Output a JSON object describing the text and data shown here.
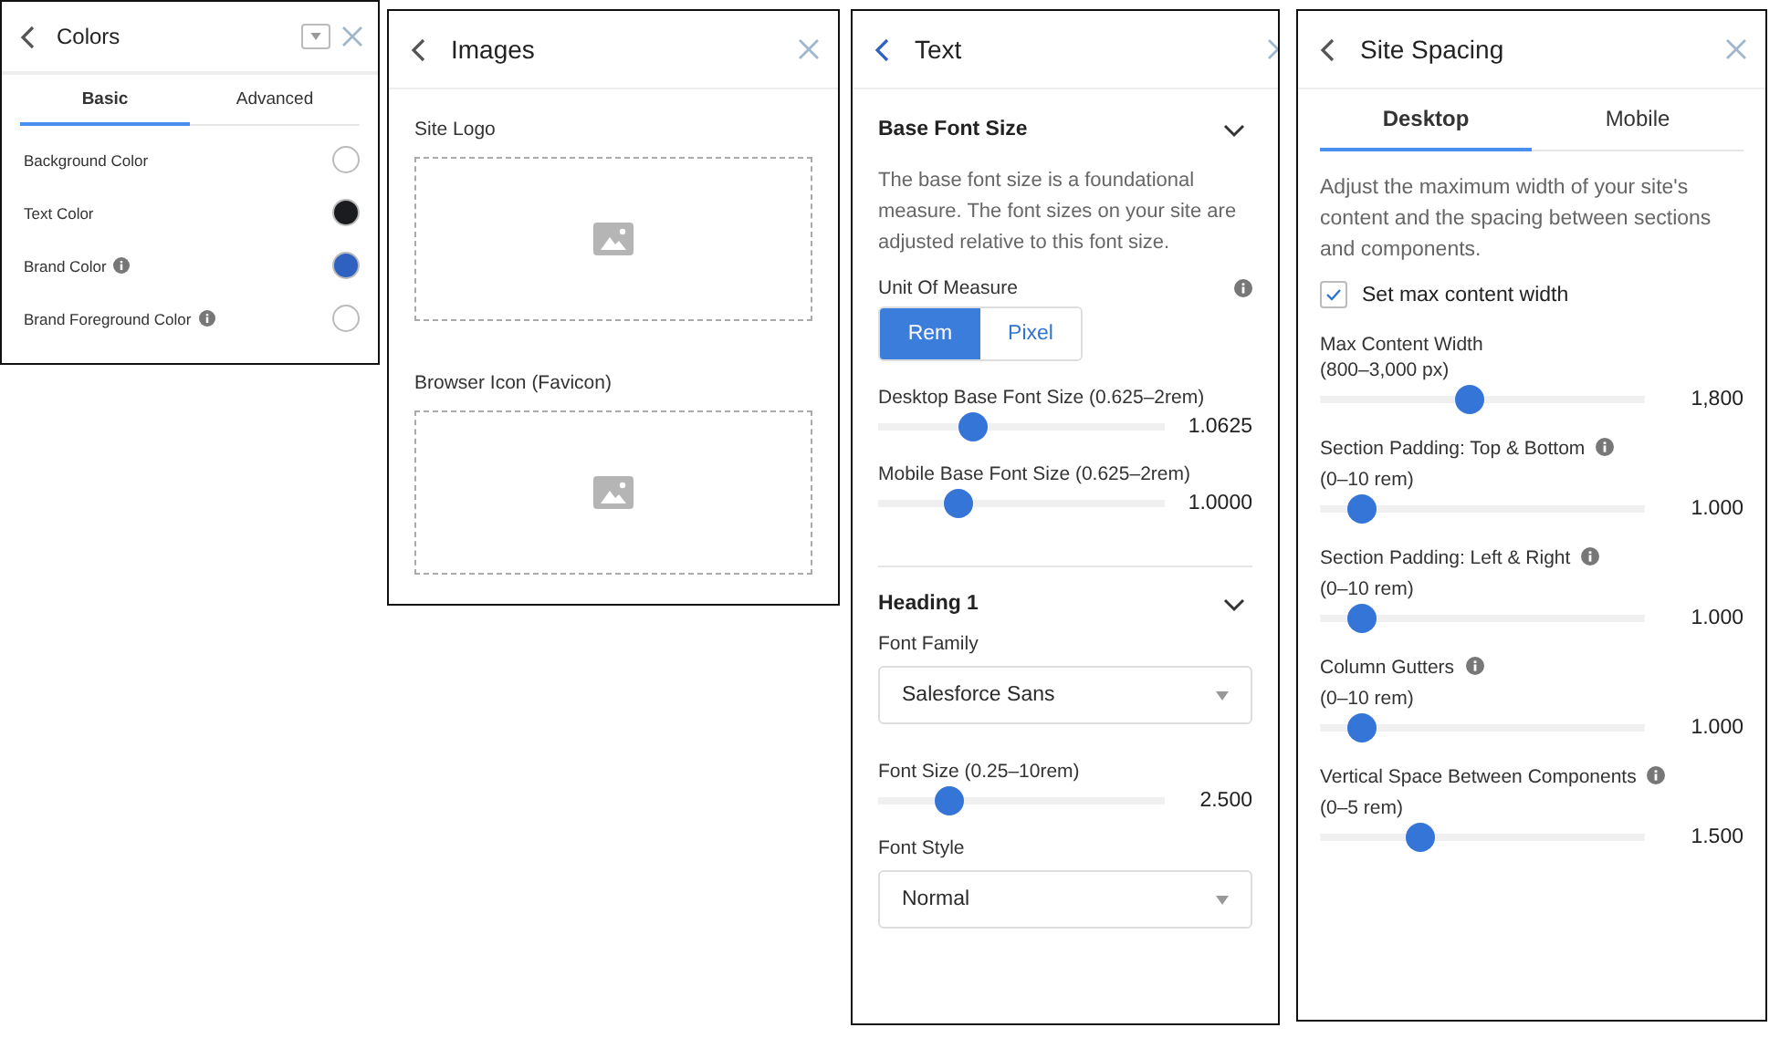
{
  "colors_panel": {
    "title": "Colors",
    "tabs": [
      {
        "label": "Basic",
        "selected": true
      },
      {
        "label": "Advanced",
        "selected": false
      }
    ],
    "items": [
      {
        "label": "Background Color",
        "info": false,
        "color": "#ffffff"
      },
      {
        "label": "Text Color",
        "info": false,
        "color": "#1b1c1f"
      },
      {
        "label": "Brand Color",
        "info": true,
        "color": "#2f62c0"
      },
      {
        "label": "Brand Foreground Color",
        "info": true,
        "color": "#ffffff"
      }
    ]
  },
  "images_panel": {
    "title": "Images",
    "slots": [
      {
        "label": "Site Logo"
      },
      {
        "label": "Browser Icon (Favicon)"
      }
    ]
  },
  "text_panel": {
    "title": "Text",
    "sections": [
      {
        "title": "Base Font Size",
        "expanded": true,
        "fields": [
          {
            "kind": "description",
            "text": "The base font size is a foundational measure. The font sizes on your site are adjusted relative to this font size."
          },
          {
            "kind": "toggle",
            "label": "Unit Of Measure",
            "info": true,
            "options": [
              {
                "label": "Rem",
                "selected": true
              },
              {
                "label": "Pixel",
                "selected": false
              }
            ]
          },
          {
            "kind": "slider",
            "label": "Desktop Base Font Size (0.625–2rem)",
            "level": 0.33,
            "reading": "1.0625"
          },
          {
            "kind": "slider",
            "label": "Mobile Base Font Size (0.625–2rem)",
            "level": 0.28,
            "reading": "1.0000"
          }
        ]
      },
      {
        "title": "Heading 1",
        "expanded": true,
        "fields": [
          {
            "kind": "select",
            "label": "Font Family",
            "value": "Salesforce Sans"
          },
          {
            "kind": "slider",
            "label": "Font Size (0.25–10rem)",
            "level": 0.25,
            "reading": "2.500"
          },
          {
            "kind": "select",
            "label": "Font Style",
            "value": "Normal"
          }
        ]
      }
    ]
  },
  "spacing_panel": {
    "title": "Site Spacing",
    "tabs": [
      {
        "label": "Desktop",
        "selected": true
      },
      {
        "label": "Mobile",
        "selected": false
      }
    ],
    "description": "Adjust the maximum width of your site's content and the spacing between sections and components.",
    "checkbox": {
      "label": "Set max content width",
      "checked": true
    },
    "sliders": [
      {
        "label": "Max Content Width",
        "range": "(800–3,000 px)",
        "info": false,
        "level": 0.46,
        "reading": "1,800"
      },
      {
        "label": "Section Padding: Top & Bottom",
        "range": "(0–10 rem)",
        "info": true,
        "level": 0.13,
        "reading": "1.000"
      },
      {
        "label": "Section Padding: Left & Right",
        "range": "(0–10 rem)",
        "info": true,
        "level": 0.13,
        "reading": "1.000"
      },
      {
        "label": "Column Gutters",
        "range": "(0–10 rem)",
        "info": true,
        "level": 0.13,
        "reading": "1.000"
      },
      {
        "label": "Vertical Space Between Components",
        "range": "(0–5 rem)",
        "info": true,
        "level": 0.31,
        "reading": "1.500"
      }
    ]
  }
}
